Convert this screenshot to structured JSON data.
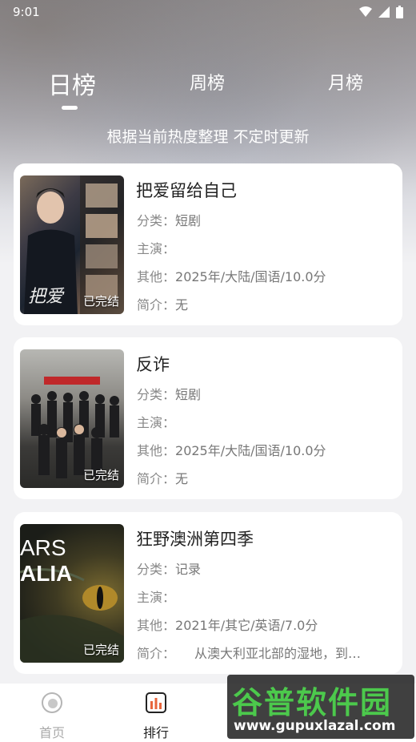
{
  "status_bar": {
    "time": "9:01"
  },
  "tabs": [
    {
      "label": "日榜",
      "active": true
    },
    {
      "label": "周榜",
      "active": false
    },
    {
      "label": "月榜",
      "active": false
    }
  ],
  "subtitle": "根据当前热度整理 不定时更新",
  "labels": {
    "category": "分类：",
    "cast": "主演：",
    "other": "其他：",
    "intro": "简介："
  },
  "items": [
    {
      "title": "把爱留给自己",
      "badge": "已完结",
      "category": "短剧",
      "cast": "",
      "other": "2025年/大陆/国语/10.0分",
      "intro": "无",
      "poster_text": "把爱"
    },
    {
      "title": "反诈",
      "badge": "已完结",
      "category": "短剧",
      "cast": "",
      "other": "2025年/大陆/国语/10.0分",
      "intro": "无"
    },
    {
      "title": "狂野澳洲第四季",
      "badge": "已完结",
      "category": "记录",
      "cast": "",
      "other": "2021年/其它/英语/7.0分",
      "intro": "　　从澳大利亚北部的湿地，到…",
      "poster_text_1": "ARS",
      "poster_text_2": "ALIA"
    }
  ],
  "bottom_nav": [
    {
      "label": "首页",
      "active": false
    },
    {
      "label": "排行",
      "active": true
    }
  ],
  "watermark": {
    "big": "谷普软件园",
    "small": "www.gupuxlazal.com"
  }
}
